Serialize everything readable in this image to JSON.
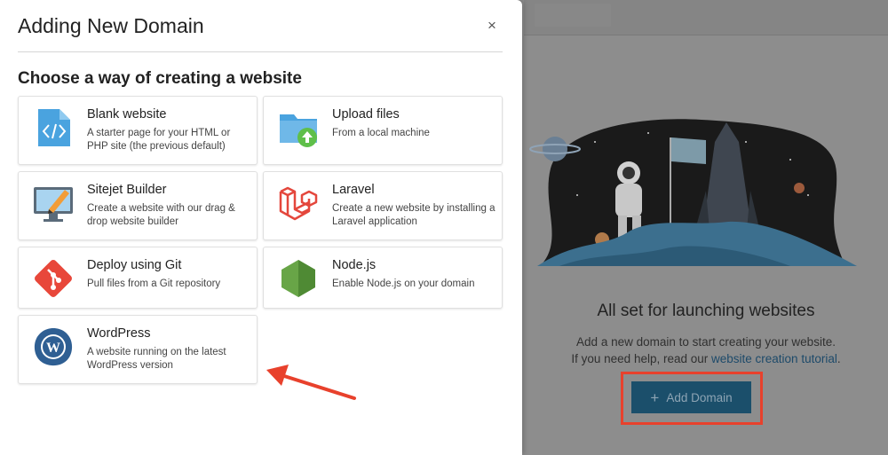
{
  "drawer": {
    "title": "Adding New Domain",
    "close_label": "×",
    "section_title": "Choose a way of creating a website"
  },
  "options": [
    {
      "title": "Blank website",
      "description": "A starter page for your HTML or PHP site (the previous default)",
      "icon": "code-file-icon"
    },
    {
      "title": "Upload files",
      "description": "From a local machine",
      "icon": "folder-upload-icon"
    },
    {
      "title": "Sitejet Builder",
      "description": "Create a website with our drag & drop website builder",
      "icon": "monitor-pencil-icon"
    },
    {
      "title": "Laravel",
      "description": "Create a new website by installing a Laravel application",
      "icon": "laravel-icon"
    },
    {
      "title": "Deploy using Git",
      "description": "Pull files from a Git repository",
      "icon": "git-icon"
    },
    {
      "title": "Node.js",
      "description": "Enable Node.js on your domain",
      "icon": "nodejs-icon"
    },
    {
      "title": "WordPress",
      "description": "A website running on the latest WordPress version",
      "icon": "wordpress-icon"
    }
  ],
  "empty_state": {
    "title": "All set for launching websites",
    "line1": "Add a new domain to start creating your website.",
    "line2_prefix": "If you need help, read our ",
    "line2_link": "website creation tutorial",
    "line2_suffix": "."
  },
  "add_domain_button": {
    "label": "Add Domain",
    "plus": "+"
  },
  "colors": {
    "highlight": "#e8412c",
    "button_bg": "#1b4f6b",
    "link": "#1d4a6a"
  }
}
